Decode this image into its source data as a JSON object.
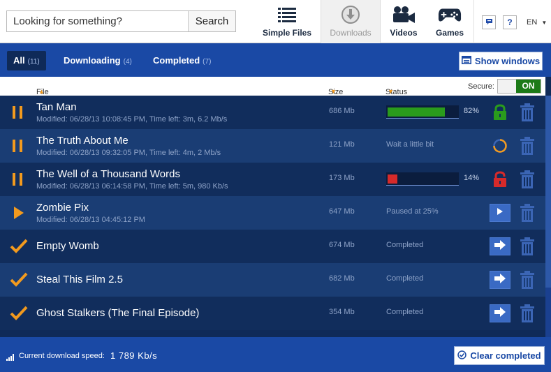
{
  "search": {
    "placeholder": "Looking for something?",
    "button_label": "Search"
  },
  "nav": {
    "simple_files": "Simple Files",
    "downloads": "Downloads",
    "videos": "Videos",
    "games": "Games"
  },
  "header_buttons": {
    "help_label": "?",
    "language": "EN"
  },
  "tabs": {
    "all": {
      "label": "All",
      "count": "(11)"
    },
    "downloading": {
      "label": "Downloading",
      "count": "(4)"
    },
    "completed": {
      "label": "Completed",
      "count": "(7)"
    }
  },
  "show_windows_label": "Show windows",
  "columns": {
    "file": "File",
    "size": "Size",
    "status": "Status",
    "secure": "Secure:",
    "secure_toggle": "ON"
  },
  "rows": [
    {
      "state": "pause",
      "name": "Tan Man",
      "meta": "Modified: 06/28/13 10:08:45 PM,  Time left: 3m,  6.2 Mb/s",
      "size": "686 Mb",
      "progress_pct": "82%",
      "progress": 0.82,
      "lock": "locked"
    },
    {
      "state": "pause",
      "name": "The Truth About Me",
      "meta": "Modified: 06/28/13 09:32:05 PM,  Time left: 4m,  2 Mb/s",
      "size": "121 Mb",
      "status": "Wait a little bit"
    },
    {
      "state": "pause",
      "name": "The Well of a Thousand Words",
      "meta": "Modified: 06/28/13 06:14:58 PM,  Time left: 5m,  980 Kb/s",
      "size": "173 Mb",
      "progress_pct": "14%",
      "progress": 0.14,
      "lock": "unlocked"
    },
    {
      "state": "play",
      "name": "Zombie Pix",
      "meta": "Modified: 06/28/13 04:45:12 PM",
      "size": "647 Mb",
      "status": "Paused at 25%"
    },
    {
      "state": "done",
      "name": "Empty Womb",
      "size": "674 Mb",
      "status": "Completed"
    },
    {
      "state": "done",
      "name": "Steal This Film 2.5",
      "size": "682 Mb",
      "status": "Completed"
    },
    {
      "state": "done",
      "name": "Ghost Stalkers (The Final Episode)",
      "size": "354 Mb",
      "status": "Completed"
    }
  ],
  "footer": {
    "speed_label": "Current download speed:",
    "speed_value": "1 789 Kb/s",
    "clear_label": "Clear completed"
  },
  "colors": {
    "progress_green": "#2a9b1c",
    "progress_red": "#d62a2a",
    "accent_orange": "#f29a1e",
    "brand_blue": "#1a49a5"
  }
}
